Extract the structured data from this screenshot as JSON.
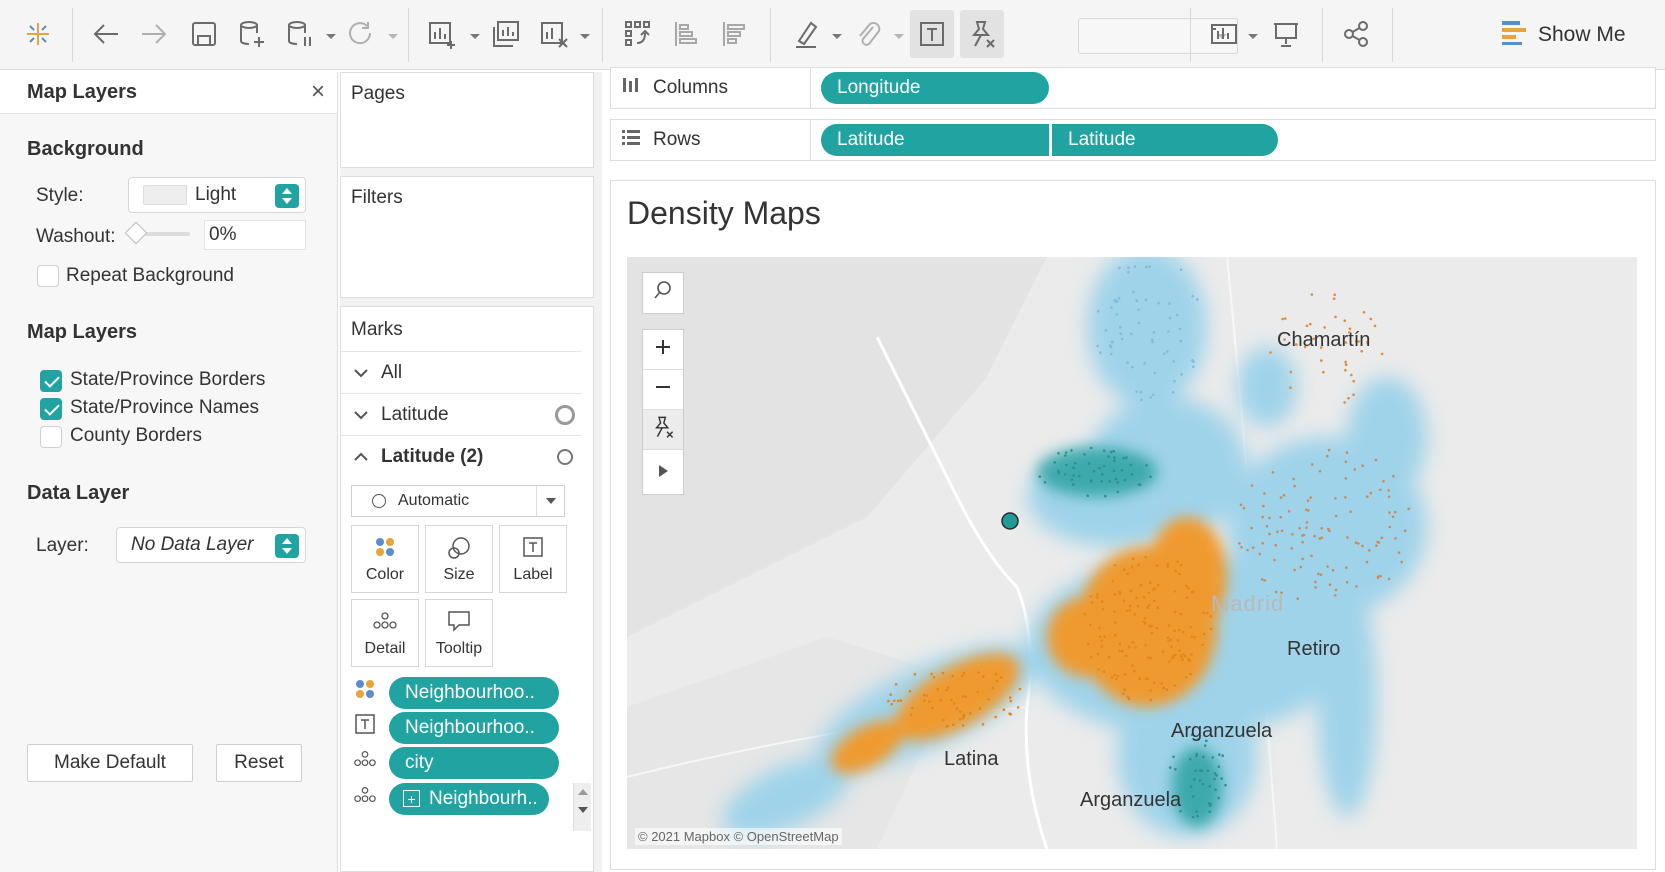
{
  "toolbar": {
    "show_me_label": "Show Me"
  },
  "map_layers_panel": {
    "title": "Map Layers",
    "background_section": "Background",
    "style_label": "Style:",
    "style_value": "Light",
    "washout_label": "Washout:",
    "washout_value": "0%",
    "repeat_background_label": "Repeat Background",
    "map_layers_section": "Map Layers",
    "layers": [
      {
        "label": "State/Province Borders",
        "checked": true
      },
      {
        "label": "State/Province Names",
        "checked": true
      },
      {
        "label": "County Borders",
        "checked": false
      }
    ],
    "data_layer_section": "Data Layer",
    "layer_label": "Layer:",
    "layer_value": "No Data Layer",
    "make_default_label": "Make Default",
    "reset_label": "Reset"
  },
  "shelves": {
    "pages_label": "Pages",
    "filters_label": "Filters",
    "columns_label": "Columns",
    "rows_label": "Rows",
    "columns_pills": [
      "Longitude"
    ],
    "rows_pills": [
      "Latitude",
      "Latitude"
    ]
  },
  "marks": {
    "title": "Marks",
    "cards": [
      {
        "label": "All",
        "expanded": false
      },
      {
        "label": "Latitude",
        "expanded": false
      },
      {
        "label": "Latitude (2)",
        "expanded": true
      }
    ],
    "mark_type": "Automatic",
    "buttons": [
      "Color",
      "Size",
      "Label",
      "Detail",
      "Tooltip"
    ],
    "fields": [
      {
        "icon": "color-icon",
        "label": "Neighbourhoo.."
      },
      {
        "icon": "label-icon",
        "label": "Neighbourhoo.."
      },
      {
        "icon": "detail-icon",
        "label": "city"
      },
      {
        "icon": "detail-icon",
        "label": "Neighbourh.."
      }
    ]
  },
  "view": {
    "title": "Density Maps",
    "map_labels": [
      "Chamartín",
      "Madrid",
      "Retiro",
      "Arganzuela",
      "Latina",
      "Arganzuela"
    ],
    "attribution": "© 2021 Mapbox © OpenStreetMap"
  },
  "colors": {
    "accent": "#20a3a1",
    "density_blue": "#9fd3ea",
    "density_orange": "#ef9a2e",
    "density_teal": "#1f9b99"
  }
}
